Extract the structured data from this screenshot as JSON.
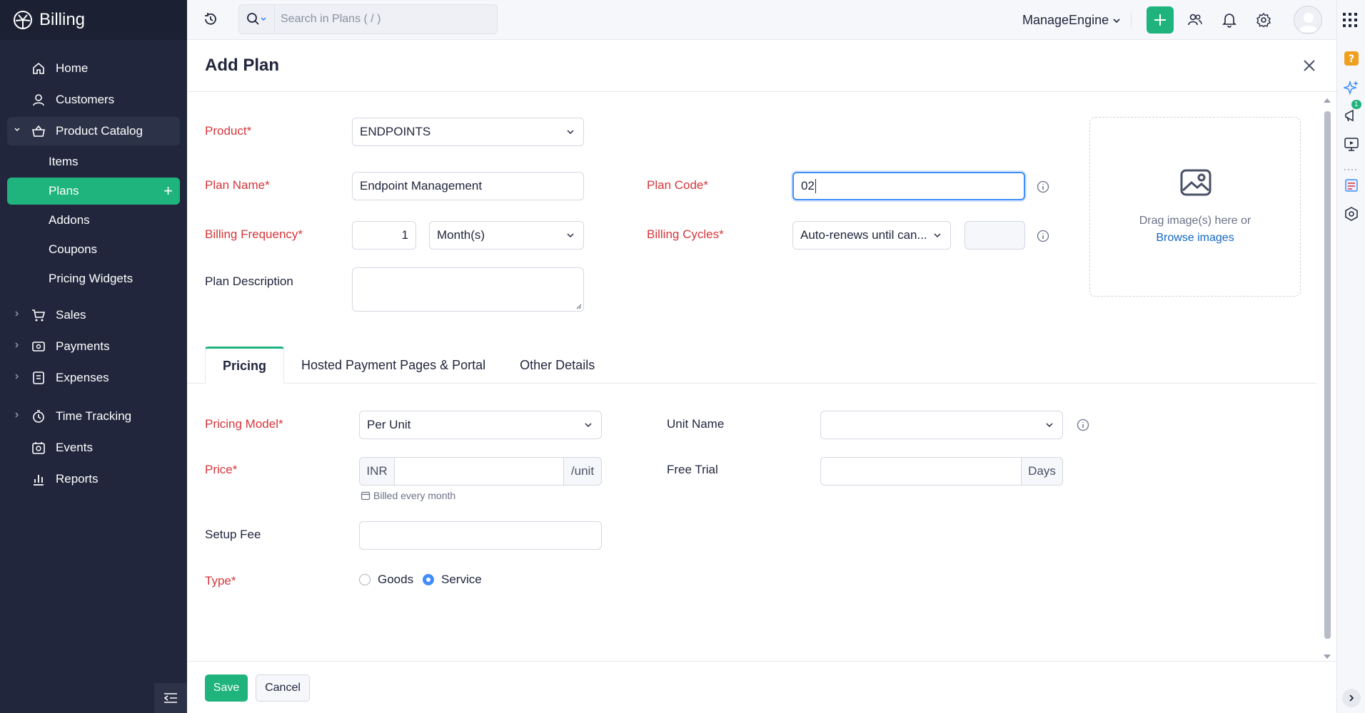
{
  "app": {
    "name": "Billing"
  },
  "colors": {
    "accent": "#1fb37d",
    "sidebar_bg": "#21263c",
    "required": "#d6363b",
    "focus": "#408dfb",
    "link": "#1467c4"
  },
  "sidebar": {
    "items": [
      {
        "label": "Home",
        "icon": "home-icon"
      },
      {
        "label": "Customers",
        "icon": "user-icon"
      },
      {
        "label": "Product Catalog",
        "icon": "basket-icon",
        "open": true
      },
      {
        "label": "Sales",
        "icon": "cart-icon"
      },
      {
        "label": "Payments",
        "icon": "payments-icon"
      },
      {
        "label": "Expenses",
        "icon": "expenses-icon"
      },
      {
        "label": "Time Tracking",
        "icon": "timer-icon"
      },
      {
        "label": "Events",
        "icon": "events-icon"
      },
      {
        "label": "Reports",
        "icon": "reports-icon"
      }
    ],
    "catalog_sub": [
      {
        "label": "Items"
      },
      {
        "label": "Plans",
        "active": true
      },
      {
        "label": "Addons"
      },
      {
        "label": "Coupons"
      },
      {
        "label": "Pricing Widgets"
      }
    ],
    "plans_add": "+"
  },
  "topbar": {
    "search_placeholder": "Search in Plans ( / )",
    "org_name": "ManageEngine"
  },
  "form": {
    "title": "Add Plan",
    "product_label": "Product*",
    "product_value": "ENDPOINTS",
    "plan_name_label": "Plan Name*",
    "plan_name_value": "Endpoint Management",
    "plan_code_label": "Plan Code*",
    "plan_code_value": "02",
    "billing_frequency_label": "Billing Frequency*",
    "billing_frequency_value": "1",
    "billing_frequency_unit": "Month(s)",
    "billing_cycles_label": "Billing Cycles*",
    "billing_cycles_value": "Auto-renews until can...",
    "billing_cycles_count": "",
    "plan_description_label": "Plan Description",
    "dropzone_text": "Drag image(s) here or",
    "dropzone_link": "Browse images"
  },
  "tabs": [
    {
      "label": "Pricing",
      "active": true
    },
    {
      "label": "Hosted Payment Pages & Portal"
    },
    {
      "label": "Other Details"
    }
  ],
  "pricing": {
    "pricing_model_label": "Pricing Model*",
    "pricing_model_value": "Per Unit",
    "unit_name_label": "Unit Name",
    "unit_name_value": "",
    "price_label": "Price*",
    "price_currency": "INR",
    "price_value": "",
    "price_suffix": "/unit",
    "billed_hint": "Billed every month",
    "free_trial_label": "Free Trial",
    "free_trial_value": "",
    "free_trial_suffix": "Days",
    "setup_fee_label": "Setup Fee",
    "setup_fee_value": "",
    "type_label": "Type*",
    "type_options": [
      {
        "label": "Goods",
        "selected": false
      },
      {
        "label": "Service",
        "selected": true
      }
    ]
  },
  "footer": {
    "save_label": "Save",
    "cancel_label": "Cancel"
  },
  "rail": {
    "badge_count": "1"
  }
}
